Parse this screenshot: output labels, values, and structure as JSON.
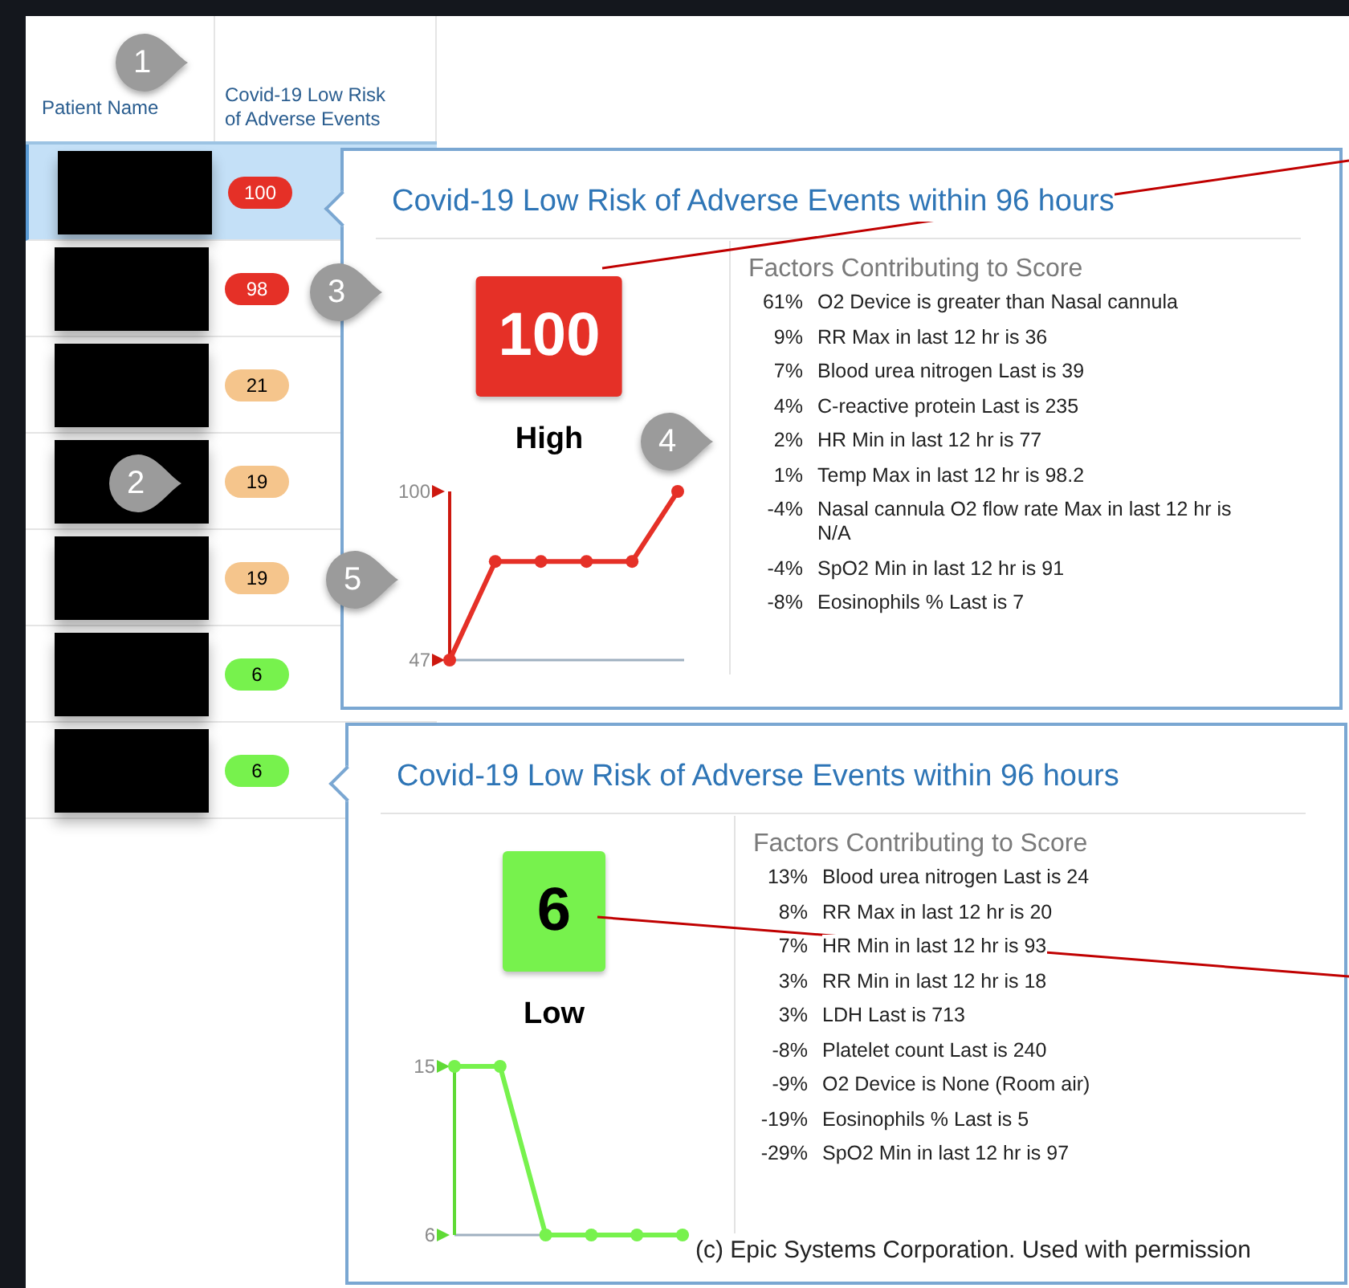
{
  "table": {
    "columns": [
      "Patient Name",
      "Covid-19 Low Risk of Adverse Events"
    ],
    "rows": [
      {
        "score": "100",
        "color": "#e53027",
        "selected": true
      },
      {
        "score": "98",
        "color": "#e53027",
        "selected": false
      },
      {
        "score": "21",
        "color": "#f5c58c",
        "selected": false
      },
      {
        "score": "19",
        "color": "#f5c58c",
        "selected": false
      },
      {
        "score": "19",
        "color": "#f5c58c",
        "selected": false
      },
      {
        "score": "6",
        "color": "#77f24d",
        "selected": false
      },
      {
        "score": "6",
        "color": "#77f24d",
        "selected": false
      }
    ]
  },
  "popups": [
    {
      "title": "Covid-19 Low Risk of Adverse Events within 96 hours",
      "score": "100",
      "color": "#e53027",
      "risk_label": "High",
      "chart_data": {
        "type": "line",
        "series": [
          {
            "color": "#e53027",
            "marker": "circle",
            "values": [
              47,
              78,
              78,
              78,
              78,
              100
            ]
          }
        ],
        "ylim": [
          47,
          100
        ],
        "yticks": [
          47,
          100
        ]
      },
      "factors_title": "Factors Contributing to Score",
      "factors": [
        {
          "percent": "61%",
          "text": "O2 Device is greater than Nasal cannula"
        },
        {
          "percent": "9%",
          "text": "RR Max in last 12 hr is 36"
        },
        {
          "percent": "7%",
          "text": "Blood urea nitrogen Last is 39"
        },
        {
          "percent": "4%",
          "text": "C-reactive protein Last is 235"
        },
        {
          "percent": "2%",
          "text": "HR Min in last 12 hr is 77"
        },
        {
          "percent": "1%",
          "text": "Temp Max in last 12 hr is 98.2"
        },
        {
          "percent": "-4%",
          "text": "Nasal cannula O2 flow rate Max in last 12 hr is N/A"
        },
        {
          "percent": "-4%",
          "text": "SpO2 Min in last 12 hr is 91"
        },
        {
          "percent": "-8%",
          "text": "Eosinophils % Last is 7"
        }
      ]
    },
    {
      "title": "Covid-19 Low Risk of Adverse Events within 96 hours",
      "score": "6",
      "color": "#77f24d",
      "risk_label": "Low",
      "chart_data": {
        "type": "line",
        "series": [
          {
            "color": "#77f24d",
            "marker": "circle",
            "values": [
              15,
              15,
              6,
              6,
              6,
              6
            ]
          }
        ],
        "ylim": [
          6,
          15
        ],
        "yticks": [
          6,
          15
        ]
      },
      "factors_title": "Factors Contributing to Score",
      "factors": [
        {
          "percent": "13%",
          "text": "Blood urea nitrogen Last is 24"
        },
        {
          "percent": "8%",
          "text": "RR Max in last 12 hr is 20"
        },
        {
          "percent": "7%",
          "text": "HR Min in last 12 hr is 93"
        },
        {
          "percent": "3%",
          "text": "RR Min in last 12 hr is 18"
        },
        {
          "percent": "3%",
          "text": "LDH Last is 713"
        },
        {
          "percent": "-8%",
          "text": "Platelet count Last is 240"
        },
        {
          "percent": "-9%",
          "text": "O2 Device is None (Room air)"
        },
        {
          "percent": "-19%",
          "text": "Eosinophils % Last is 5"
        },
        {
          "percent": "-29%",
          "text": "SpO2 Min in last 12 hr is 97"
        }
      ],
      "footer": "(c) Epic Systems Corporation. Used with permission"
    }
  ],
  "callouts": [
    "1",
    "2",
    "3",
    "4",
    "5"
  ]
}
